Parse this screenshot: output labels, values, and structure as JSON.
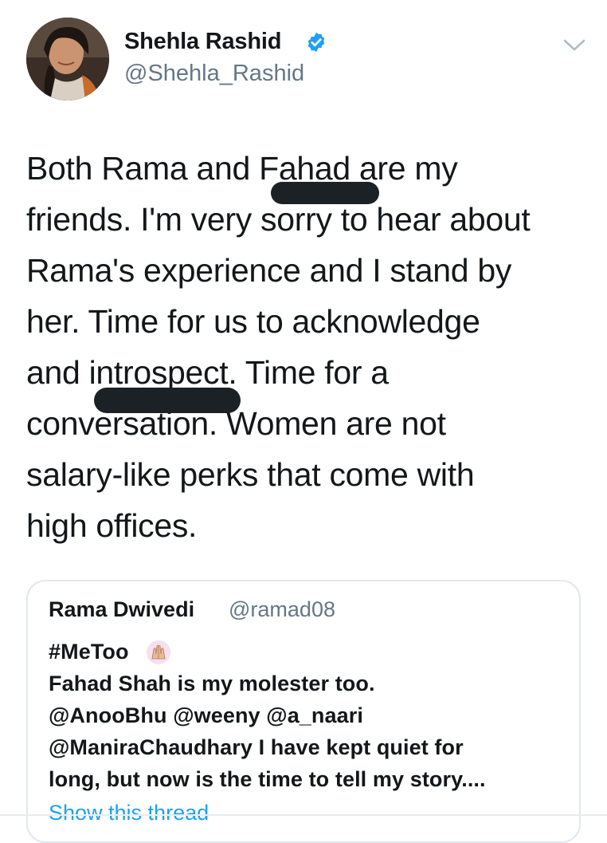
{
  "author": {
    "display_name": "Shehla Rashid",
    "handle": "@Shehla_Rashid",
    "verified": true,
    "avatar_icon": "profile-photo"
  },
  "menu": {
    "icon": "chevron-down-icon"
  },
  "tweet": {
    "text": "Both Rama and Fahad are my\nfriends. I'm very sorry to hear about\nRama's experience and I stand by\nher. Time for us to acknowledge\nand introspect. Time for a\nconversation. Women are not\nsalary-like perks that come with\nhigh offices."
  },
  "quoted_tweet": {
    "display_name": "Rama Dwivedi",
    "handle": "@ramad08",
    "text": "#MeToo  \nFahad Shah is my molester too.\n@AnooBhu @weeny @a_naari\n@ManiraChaudhary I have kept quiet for\nlong, but now is the time to tell my story....",
    "emoji": "raised-hands-icon",
    "show_thread": "Show this thread"
  },
  "colors": {
    "text": "#14171a",
    "secondary": "#657786",
    "link": "#1da1f2",
    "verified_badge": "#1da1f2",
    "border": "#e1e8ed"
  }
}
